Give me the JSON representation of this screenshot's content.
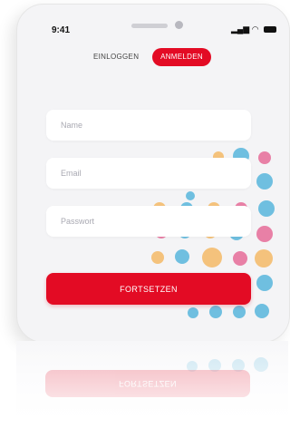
{
  "status_bar": {
    "time": "9:41",
    "signal_icon": "signal-bars-icon",
    "wifi_icon": "wifi-icon",
    "battery_icon": "battery-icon"
  },
  "tabs": {
    "login_label": "EINLOGGEN",
    "register_label": "ANMELDEN"
  },
  "form": {
    "name_placeholder": "Name",
    "email_placeholder": "Email",
    "password_placeholder": "Passwort",
    "submit_label": "FORTSETZEN"
  },
  "colors": {
    "accent": "#e30b24",
    "dot_orange": "#f4c27c",
    "dot_blue": "#6fbfe0",
    "dot_pink": "#e880a6",
    "background": "#f4f4f6"
  }
}
